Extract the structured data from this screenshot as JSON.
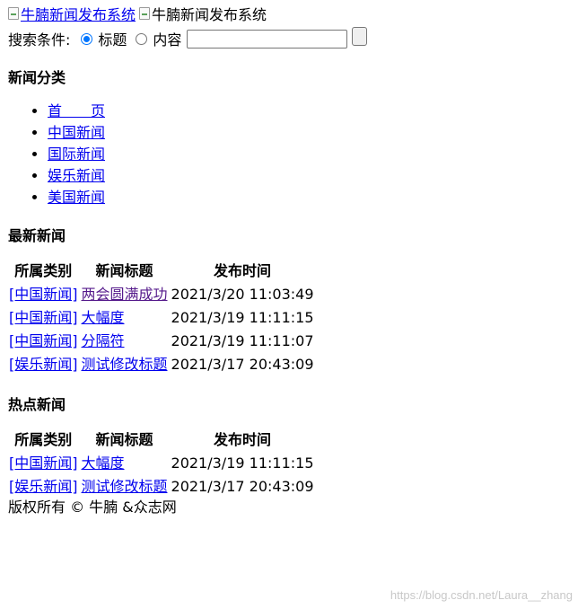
{
  "header": {
    "logo_alt": "牛腩新闻发布系统",
    "banner_alt": "牛腩新闻发布系统"
  },
  "search": {
    "label": "搜索条件:",
    "option_title": "标题",
    "option_content": "内容",
    "query_value": ""
  },
  "categories": {
    "heading": "新闻分类",
    "items": [
      {
        "label": "首　　页"
      },
      {
        "label": "中国新闻"
      },
      {
        "label": "国际新闻"
      },
      {
        "label": "娱乐新闻"
      },
      {
        "label": "美国新闻"
      }
    ]
  },
  "latest": {
    "heading": "最新新闻",
    "columns": [
      "所属类别",
      "新闻标题",
      "发布时间"
    ],
    "rows": [
      {
        "category": "[中国新闻]",
        "title": "两会圆满成功",
        "time": "2021/3/20 11:03:49"
      },
      {
        "category": "[中国新闻]",
        "title": "大幅度",
        "time": "2021/3/19 11:11:15"
      },
      {
        "category": "[中国新闻]",
        "title": "分隔符",
        "time": "2021/3/19 11:11:07"
      },
      {
        "category": "[娱乐新闻]",
        "title": "测试修改标题",
        "time": "2021/3/17 20:43:09"
      }
    ]
  },
  "hot": {
    "heading": "热点新闻",
    "columns": [
      "所属类别",
      "新闻标题",
      "发布时间"
    ],
    "rows": [
      {
        "category": "[中国新闻]",
        "title": "大幅度",
        "time": "2021/3/19 11:11:15"
      },
      {
        "category": "[娱乐新闻]",
        "title": "测试修改标题",
        "time": "2021/3/17 20:43:09"
      }
    ]
  },
  "footer": {
    "text": "版权所有 © 牛腩 &众志网"
  },
  "watermark": {
    "text": "https://blog.csdn.net/Laura__zhang"
  },
  "colors": {
    "link": "#0000ee",
    "visited": "#551a8b",
    "radio_accent": "#0075ff"
  }
}
